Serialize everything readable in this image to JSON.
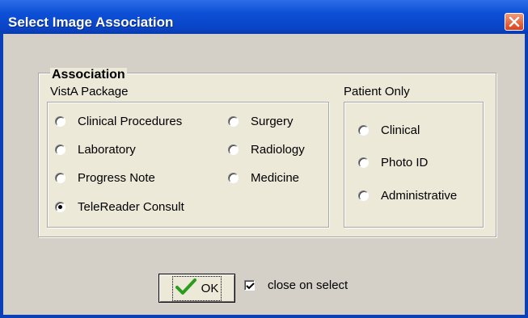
{
  "window": {
    "title": "Select Image Association"
  },
  "association": {
    "group_label": "Association",
    "vista": {
      "label": "VistA Package",
      "options": [
        {
          "label": "Clinical Procedures",
          "selected": false
        },
        {
          "label": "Laboratory",
          "selected": false
        },
        {
          "label": "Progress Note",
          "selected": false
        },
        {
          "label": "TeleReader Consult",
          "selected": true
        },
        {
          "label": "Surgery",
          "selected": false
        },
        {
          "label": "Radiology",
          "selected": false
        },
        {
          "label": "Medicine",
          "selected": false
        }
      ]
    },
    "patient": {
      "label": "Patient Only",
      "options": [
        {
          "label": "Clinical",
          "selected": false
        },
        {
          "label": "Photo ID",
          "selected": false
        },
        {
          "label": "Administrative",
          "selected": false
        }
      ]
    }
  },
  "footer": {
    "ok_label": "OK",
    "close_on_select_label": "close on select",
    "close_on_select_checked": true
  },
  "colors": {
    "titlebar": "#0c4fd6",
    "face": "#d4d0c8",
    "group_face": "#ece9d8",
    "check_green": "#2a9d1f",
    "close_red": "#d9421c"
  }
}
